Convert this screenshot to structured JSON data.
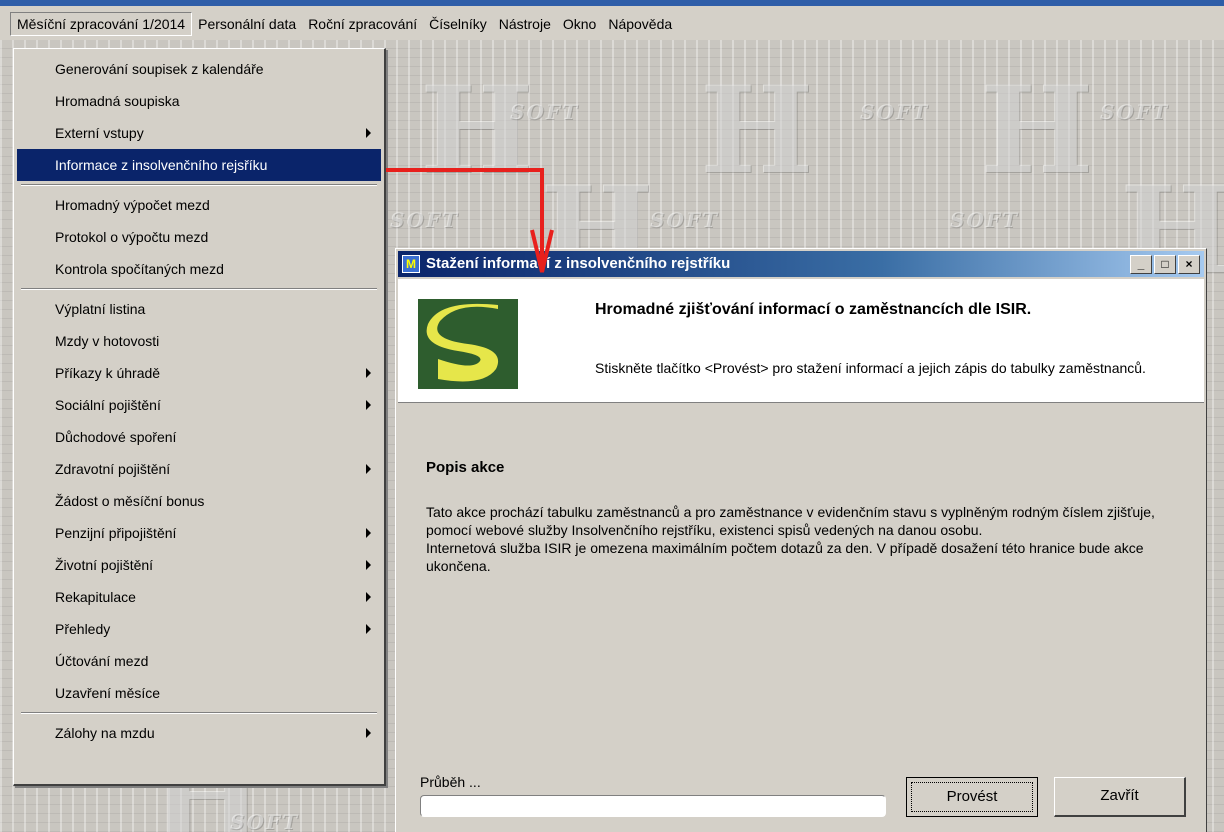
{
  "menubar": {
    "items": [
      {
        "label": "Měsíční zpracování 1/2014",
        "active": true
      },
      {
        "label": "Personální data"
      },
      {
        "label": "Roční zpracování"
      },
      {
        "label": "Číselníky"
      },
      {
        "label": "Nástroje"
      },
      {
        "label": "Okno"
      },
      {
        "label": "Nápověda"
      }
    ]
  },
  "watermark": {
    "letter": "H",
    "soft": "SOFT"
  },
  "dropdown": {
    "items": [
      {
        "label": "Generování soupisek z kalendáře"
      },
      {
        "label": "Hromadná soupiska"
      },
      {
        "label": "Externí vstupy",
        "submenu": true
      },
      {
        "label": "Informace z insolvenčního rejsříku",
        "highlight": true
      },
      {
        "label": "Hromadný výpočet mezd"
      },
      {
        "label": "Protokol o výpočtu mezd"
      },
      {
        "label": "Kontrola spočítaných mezd"
      },
      {
        "label": "Výplatní listina"
      },
      {
        "label": "Mzdy v hotovosti"
      },
      {
        "label": "Příkazy k úhradě",
        "submenu": true
      },
      {
        "label": "Sociální pojištění",
        "submenu": true
      },
      {
        "label": "Důchodové spoření"
      },
      {
        "label": "Zdravotní pojištění",
        "submenu": true
      },
      {
        "label": "Žádost o měsíční bonus"
      },
      {
        "label": "Penzijní připojištění",
        "submenu": true
      },
      {
        "label": "Životní pojištění",
        "submenu": true
      },
      {
        "label": "Rekapitulace",
        "submenu": true
      },
      {
        "label": "Přehledy",
        "submenu": true
      },
      {
        "label": "Účtování mezd"
      },
      {
        "label": "Uzavření měsíce"
      },
      {
        "label": "Zálohy na mzdu",
        "submenu": true
      }
    ]
  },
  "dialog": {
    "title": "Stažení informací z insolvenčního rejstříku",
    "icon": "app-icon",
    "minimize": "_",
    "maximize": "□",
    "close": "×",
    "header_title": "Hromadné zjišťování informací o zaměstnancích dle ISIR.",
    "header_desc": "Stiskněte tlačítko <Provést> pro stažení informací a jejich zápis do tabulky zaměstnanců.",
    "section_title": "Popis akce",
    "section_para1": "Tato akce prochází tabulku zaměstnanců a pro zaměstnance v evidenčním stavu s vyplněným rodným číslem zjišťuje, pomocí webové služby Insolvenčního rejstříku, existenci spisů vedených na danou osobu.",
    "section_para2": "Internetová služba ISIR je omezena maximálním počtem dotazů za den. V případě dosažení této hranice bude akce ukončena.",
    "progress_label": "Průběh ...",
    "progress": 0,
    "btn_provest": "Provést",
    "btn_zavrit": "Zavřít"
  },
  "colors": {
    "menu_highlight": "#0a246a",
    "annotation_arrow": "#e8201c",
    "logo_green": "#2e5d2e",
    "logo_yellow": "#e6e64a"
  }
}
